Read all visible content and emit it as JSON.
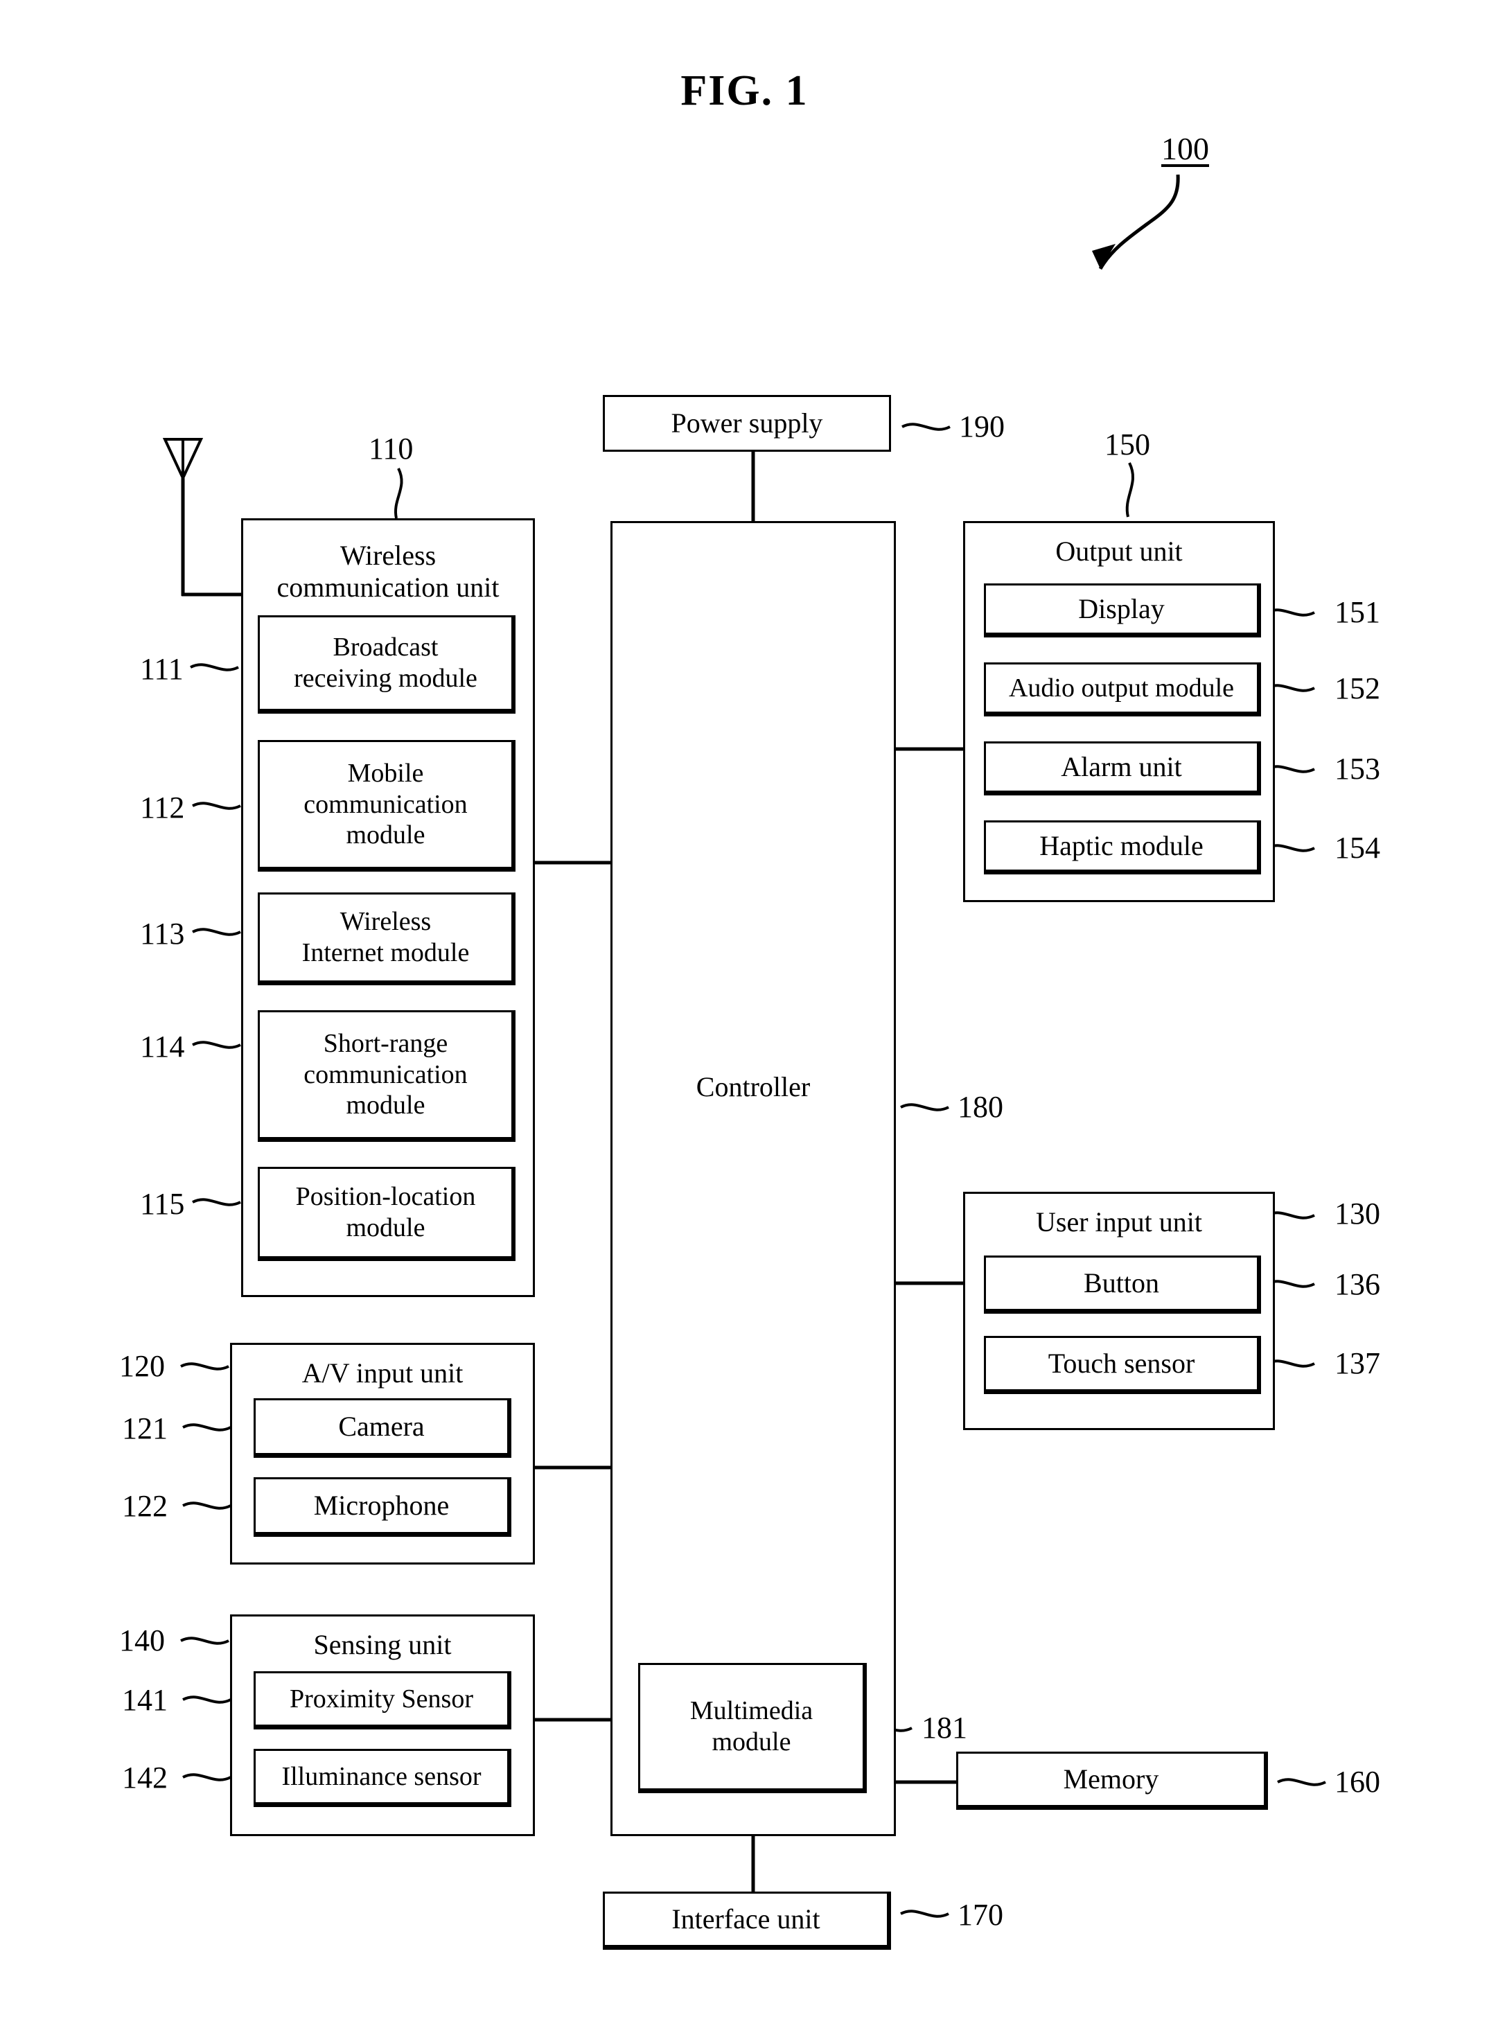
{
  "figure": {
    "title": "FIG. 1",
    "device_ref": "100"
  },
  "blocks": {
    "power_supply": {
      "label": "Power supply",
      "ref": "190"
    },
    "controller": {
      "label": "Controller",
      "ref": "180"
    },
    "multimedia_module": {
      "label": "Multimedia\nmodule",
      "label_line1": "Multimedia",
      "label_line2": "module",
      "ref": "181"
    },
    "memory": {
      "label": "Memory",
      "ref": "160"
    },
    "interface_unit": {
      "label": "Interface unit",
      "ref": "170"
    },
    "wireless_communication_unit": {
      "title_line1": "Wireless",
      "title_line2": "communication unit",
      "ref": "110",
      "modules": [
        {
          "ref": "111",
          "line1": "Broadcast",
          "line2": "receiving module",
          "line3": ""
        },
        {
          "ref": "112",
          "line1": "Mobile",
          "line2": "communication",
          "line3": "module"
        },
        {
          "ref": "113",
          "line1": "Wireless",
          "line2": "Internet module",
          "line3": ""
        },
        {
          "ref": "114",
          "line1": "Short-range",
          "line2": "communication",
          "line3": "module"
        },
        {
          "ref": "115",
          "line1": "Position-location",
          "line2": "module",
          "line3": ""
        }
      ]
    },
    "av_input_unit": {
      "title": "A/V input unit",
      "ref": "120",
      "modules": [
        {
          "ref": "121",
          "label": "Camera"
        },
        {
          "ref": "122",
          "label": "Microphone"
        }
      ]
    },
    "sensing_unit": {
      "title": "Sensing unit",
      "ref": "140",
      "modules": [
        {
          "ref": "141",
          "label": "Proximity Sensor"
        },
        {
          "ref": "142",
          "label": "Illuminance sensor"
        }
      ]
    },
    "output_unit": {
      "title": "Output unit",
      "ref": "150",
      "modules": [
        {
          "ref": "151",
          "label": "Display"
        },
        {
          "ref": "152",
          "label": "Audio output module"
        },
        {
          "ref": "153",
          "label": "Alarm  unit"
        },
        {
          "ref": "154",
          "label": "Haptic module"
        }
      ]
    },
    "user_input_unit": {
      "title": "User input unit",
      "ref": "130",
      "modules": [
        {
          "ref": "136",
          "label": "Button"
        },
        {
          "ref": "137",
          "label": "Touch sensor"
        }
      ]
    }
  },
  "icons": {
    "antenna": "antenna-icon",
    "pointer": "curved-arrow-icon"
  },
  "colors": {
    "ink": "#000000",
    "paper": "#ffffff"
  }
}
